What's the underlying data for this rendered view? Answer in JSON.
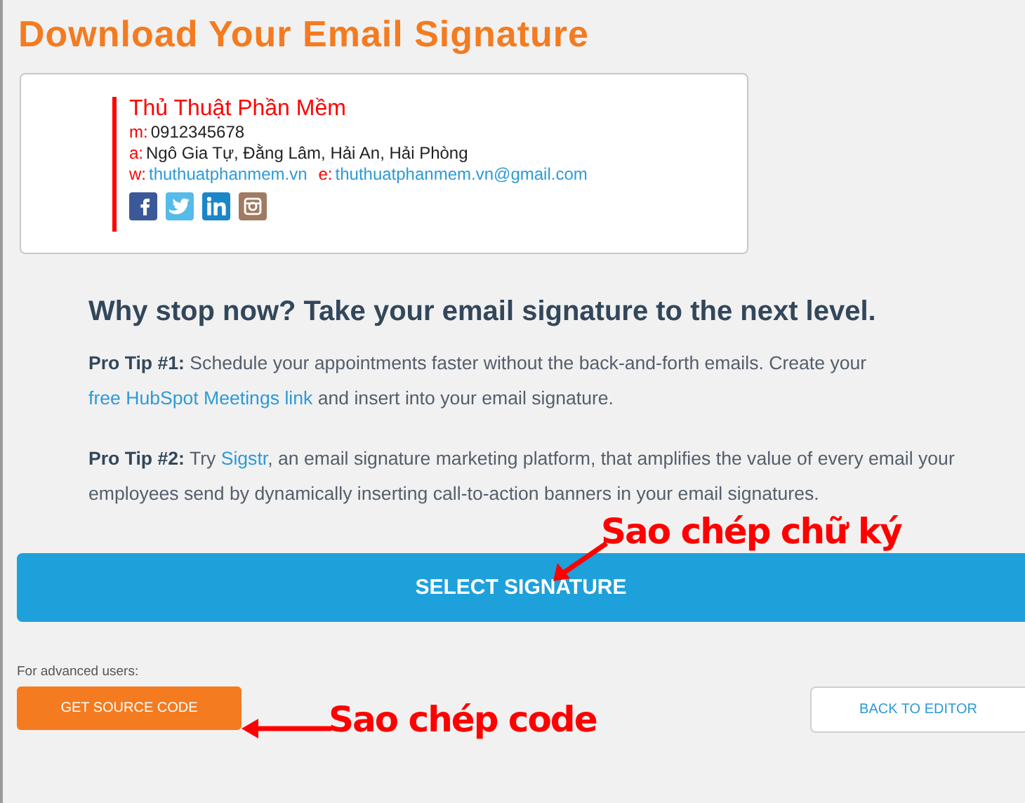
{
  "title": "Download Your Email Signature",
  "signature": {
    "name": "Thủ Thuật Phần Mềm",
    "lines": [
      {
        "fields": [
          {
            "label": "m:",
            "value": "0912345678",
            "kind": "text"
          }
        ]
      },
      {
        "fields": [
          {
            "label": "a:",
            "value": "Ngô Gia Tự, Đằng Lâm, Hải An, Hải Phòng",
            "kind": "text"
          }
        ]
      },
      {
        "fields": [
          {
            "label": "w:",
            "value": "thuthuatphanmem.vn",
            "kind": "link"
          },
          {
            "label": "e:",
            "value": "thuthuatphanmem.vn@gmail.com",
            "kind": "link"
          }
        ]
      }
    ],
    "social": [
      {
        "kind": "facebook",
        "color": "#3b5998"
      },
      {
        "kind": "twitter",
        "color": "#55bbe8"
      },
      {
        "kind": "linkedin",
        "color": "#1b86c8"
      },
      {
        "kind": "instagram",
        "color": "#a07b62"
      }
    ]
  },
  "heading": "Why stop now? Take your email signature to the next level.",
  "tips": [
    {
      "label": "Pro Tip #1:",
      "parts": [
        {
          "kind": "text",
          "text": " Schedule your appointments faster without the back-and-forth emails. Create your "
        },
        {
          "kind": "link",
          "text": "free HubSpot Meetings link"
        },
        {
          "kind": "text",
          "text": " and insert into your email signature."
        }
      ]
    },
    {
      "label": "Pro Tip #2:",
      "parts": [
        {
          "kind": "text",
          "text": " Try "
        },
        {
          "kind": "link",
          "text": "Sigstr"
        },
        {
          "kind": "text",
          "text": ", an email signature marketing platform, that amplifies the value of every email your employees send by dynamically inserting call-to-action banners in your email signatures."
        }
      ]
    }
  ],
  "select_button": "SELECT SIGNATURE",
  "advanced_label": "For advanced users:",
  "source_button": "GET SOURCE CODE",
  "back_button": "BACK TO EDITOR",
  "annotations": [
    {
      "text": "Sao chép chữ ký",
      "kind": "down"
    },
    {
      "text": "Sao chép code",
      "kind": "left"
    }
  ]
}
